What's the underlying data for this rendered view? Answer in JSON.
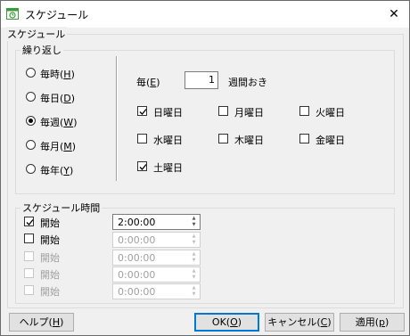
{
  "window": {
    "title": "スケジュール",
    "close_glyph": "✕"
  },
  "schedule_group": {
    "label": "スケジュール"
  },
  "repeat_group": {
    "label": "繰り返し",
    "radios": [
      {
        "label": "毎時(",
        "key": "H",
        "checked": false
      },
      {
        "label": "毎日(",
        "key": "D",
        "checked": false
      },
      {
        "label": "毎週(",
        "key": "W",
        "checked": true
      },
      {
        "label": "毎月(",
        "key": "M",
        "checked": false
      },
      {
        "label": "毎年(",
        "key": "Y",
        "checked": false
      }
    ],
    "every": {
      "label": "毎(",
      "key": "E",
      "value": "1",
      "suffix": "週間おき"
    },
    "weekdays": [
      {
        "label": "日曜日",
        "checked": true
      },
      {
        "label": "月曜日",
        "checked": false
      },
      {
        "label": "火曜日",
        "checked": false
      },
      {
        "label": "水曜日",
        "checked": false
      },
      {
        "label": "木曜日",
        "checked": false
      },
      {
        "label": "金曜日",
        "checked": false
      },
      {
        "label": "土曜日",
        "checked": true
      }
    ]
  },
  "time_group": {
    "label": "スケジュール時間",
    "rows": [
      {
        "label": "開始",
        "checked": true,
        "enabled": true,
        "time": "2:00:00"
      },
      {
        "label": "開始",
        "checked": false,
        "enabled": true,
        "time": "0:00:00"
      },
      {
        "label": "開始",
        "checked": false,
        "enabled": false,
        "time": "0:00:00"
      },
      {
        "label": "開始",
        "checked": false,
        "enabled": false,
        "time": "0:00:00"
      },
      {
        "label": "開始",
        "checked": false,
        "enabled": false,
        "time": "0:00:00"
      }
    ]
  },
  "buttons": {
    "help": {
      "label": "ヘルプ(",
      "key": "H"
    },
    "ok": {
      "label": "OK(",
      "key": "O"
    },
    "cancel": {
      "label": "キャンセル(",
      "key": "C"
    },
    "apply": {
      "label": "適用(",
      "key": "p"
    }
  },
  "colors": {
    "accent": "#0078d7",
    "calendar_icon": "#3a9a3a"
  }
}
